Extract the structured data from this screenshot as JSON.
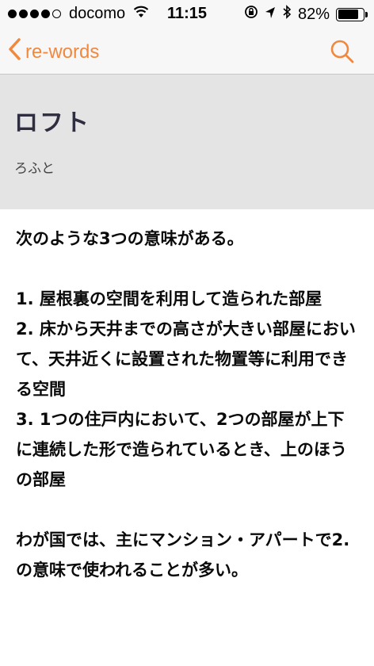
{
  "status_bar": {
    "carrier": "docomo",
    "time": "11:15",
    "battery": "82%",
    "battery_level": 0.82
  },
  "nav": {
    "back_label": "re-words",
    "accent_color": "#f0883e"
  },
  "word": {
    "title": "ロフト",
    "reading": "ろふと"
  },
  "definition": {
    "intro": "次のような3つの意味がある。",
    "items": [
      "1. 屋根裏の空間を利用して造られた部屋",
      "2. 床から天井までの高さが大きい部屋において、天井近くに設置された物置等に利用できる空間",
      "3. 1つの住戸内において、2つの部屋が上下に連続した形で造られているとき、上のほうの部屋"
    ],
    "note": "わが国では、主にマンション・アパートで2. の意味で使われることが多い。"
  }
}
